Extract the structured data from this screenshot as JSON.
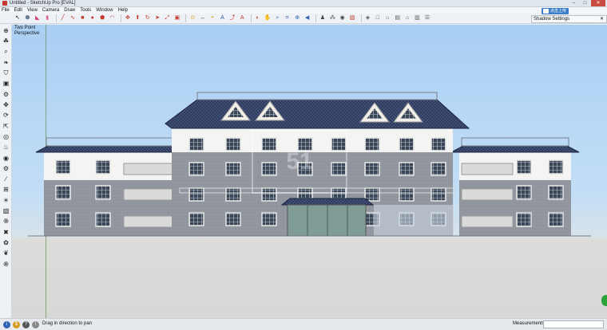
{
  "window": {
    "title": "Untitled - SketchUp Pro [EVAL]",
    "controls": [
      "–",
      "□",
      "✕"
    ]
  },
  "menu": [
    "File",
    "Edit",
    "View",
    "Camera",
    "Draw",
    "Tools",
    "Window",
    "Help"
  ],
  "toolbar": [
    {
      "icon": "select-arrow-icon",
      "glyph": "↖",
      "color": "#222222"
    },
    {
      "icon": "component-icon",
      "glyph": "⬢",
      "color": "#6a7f94"
    },
    {
      "icon": "paint-bucket-icon",
      "glyph": "◣",
      "color": "#d23c7a"
    },
    {
      "icon": "eraser-icon",
      "glyph": "▮",
      "color": "#e06a8b"
    },
    {
      "sep": true
    },
    {
      "icon": "pencil-line-icon",
      "glyph": "╱",
      "color": "#b0282c"
    },
    {
      "icon": "freehand-icon",
      "glyph": "∿",
      "color": "#c0392b"
    },
    {
      "icon": "rectangle-icon",
      "glyph": "■",
      "color": "#c0392b"
    },
    {
      "icon": "circle-icon",
      "glyph": "●",
      "color": "#c0392b"
    },
    {
      "icon": "polygon-icon",
      "glyph": "⬟",
      "color": "#c0392b"
    },
    {
      "icon": "arc-icon",
      "glyph": "◠",
      "color": "#c0392b"
    },
    {
      "sep": true
    },
    {
      "icon": "move-icon",
      "glyph": "✥",
      "color": "#c0392b"
    },
    {
      "icon": "push-pull-icon",
      "glyph": "⬆",
      "color": "#c0392b"
    },
    {
      "icon": "rotate-icon",
      "glyph": "↻",
      "color": "#c0392b"
    },
    {
      "icon": "follow-me-icon",
      "glyph": "➤",
      "color": "#c0392b"
    },
    {
      "icon": "scale-icon",
      "glyph": "⤢",
      "color": "#c0392b"
    },
    {
      "icon": "offset-icon",
      "glyph": "▣",
      "color": "#c0392b"
    },
    {
      "sep": true
    },
    {
      "icon": "tape-measure-icon",
      "glyph": "⊙",
      "color": "#d8a21c"
    },
    {
      "icon": "dimension-icon",
      "glyph": "↔",
      "color": "#444444"
    },
    {
      "icon": "protractor-icon",
      "glyph": "◓",
      "color": "#d8a21c"
    },
    {
      "icon": "text-icon",
      "glyph": "A",
      "color": "#2b5aa8"
    },
    {
      "icon": "axes-icon",
      "glyph": "⤴",
      "color": "#c0392b"
    },
    {
      "icon": "3d-text-icon",
      "glyph": "A",
      "color": "#c0392b"
    },
    {
      "sep": true
    },
    {
      "icon": "orbit-icon",
      "glyph": "◐",
      "color": "#c0392b"
    },
    {
      "icon": "pan-icon",
      "glyph": "✋",
      "color": "#2d63b3"
    },
    {
      "icon": "zoom-icon",
      "glyph": "⌕",
      "color": "#2d63b3"
    },
    {
      "icon": "zoom-window-icon",
      "glyph": "⌗",
      "color": "#2d63b3"
    },
    {
      "icon": "zoom-extents-icon",
      "glyph": "⊕",
      "color": "#2d63b3"
    },
    {
      "icon": "previous-view-icon",
      "glyph": "◀",
      "color": "#2d63b3"
    },
    {
      "sep": true
    },
    {
      "icon": "position-camera-icon",
      "glyph": "♟",
      "color": "#444444"
    },
    {
      "icon": "walk-icon",
      "glyph": "⁂",
      "color": "#444444"
    },
    {
      "icon": "look-around-icon",
      "glyph": "◉",
      "color": "#444444"
    },
    {
      "icon": "section-plane-icon",
      "glyph": "▧",
      "color": "#c0392b"
    },
    {
      "sep": true
    },
    {
      "icon": "iso-view-icon",
      "glyph": "◈",
      "color": "#555555"
    },
    {
      "icon": "top-view-icon",
      "glyph": "□",
      "color": "#555555"
    },
    {
      "icon": "front-view-icon",
      "glyph": "⌂",
      "color": "#555555"
    },
    {
      "icon": "right-view-icon",
      "glyph": "▤",
      "color": "#555555"
    },
    {
      "icon": "back-view-icon",
      "glyph": "⌂",
      "color": "#555555"
    },
    {
      "icon": "left-view-icon",
      "glyph": "▥",
      "color": "#555555"
    },
    {
      "icon": "layers-icon",
      "glyph": "☰",
      "color": "#555555"
    }
  ],
  "left_toolbar": [
    {
      "icon": "orbit-left-icon",
      "glyph": "⊕"
    },
    {
      "icon": "pan-left-icon",
      "glyph": "☘"
    },
    {
      "icon": "zoom-left-icon",
      "glyph": "⌕"
    },
    {
      "icon": "walk-left-icon",
      "glyph": "❧"
    },
    {
      "icon": "look-left-icon",
      "glyph": "⛉"
    },
    {
      "icon": "section-left-icon",
      "glyph": "▣"
    },
    {
      "icon": "camera-left-icon",
      "glyph": "⚙"
    },
    {
      "icon": "move-left-icon",
      "glyph": "✥"
    },
    {
      "icon": "rotate-left-icon",
      "glyph": "⟳"
    },
    {
      "icon": "scale-left-icon",
      "glyph": "⇱"
    },
    {
      "icon": "target-left-icon",
      "glyph": "◎"
    },
    {
      "icon": "fire-left-icon",
      "glyph": "♨"
    },
    {
      "icon": "ring-left-icon",
      "glyph": "◉"
    },
    {
      "icon": "gear-left-icon",
      "glyph": "⚙"
    },
    {
      "icon": "line-left-icon",
      "glyph": "∕"
    },
    {
      "icon": "grid-left-icon",
      "glyph": "⊞"
    },
    {
      "icon": "sun-left-icon",
      "glyph": "☀"
    },
    {
      "icon": "hatch-left-icon",
      "glyph": "▧"
    },
    {
      "icon": "spiral-left-icon",
      "glyph": "֎"
    },
    {
      "icon": "cross-left-icon",
      "glyph": "✖"
    },
    {
      "icon": "flower-left-icon",
      "glyph": "✿"
    },
    {
      "icon": "leaf-left-icon",
      "glyph": "❦"
    },
    {
      "icon": "swirl-left-icon",
      "glyph": "֍"
    }
  ],
  "viewport": {
    "camera_label": "Two Point",
    "projection_label": "Perspective"
  },
  "panel": {
    "upload_label": "点击上传",
    "title": "Shadow Settings",
    "close": "✕"
  },
  "status": {
    "hint": "Drag in direction to pan",
    "measurements_label": "Measurements"
  }
}
